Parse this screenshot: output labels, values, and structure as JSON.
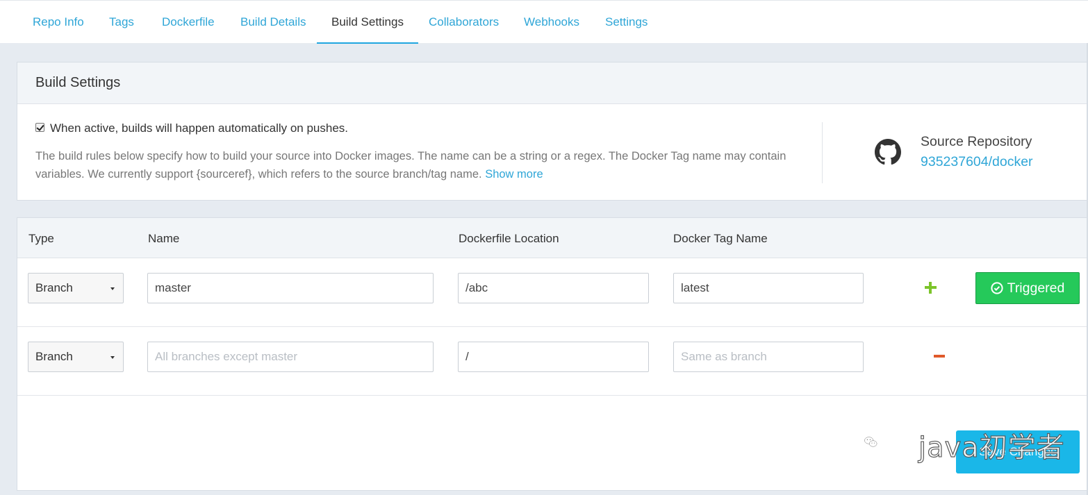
{
  "tabs": [
    {
      "label": "Repo Info"
    },
    {
      "label": "Tags"
    },
    {
      "label": "Dockerfile"
    },
    {
      "label": "Build Details"
    },
    {
      "label": "Build Settings",
      "active": true
    },
    {
      "label": "Collaborators"
    },
    {
      "label": "Webhooks"
    },
    {
      "label": "Settings"
    }
  ],
  "settings": {
    "title": "Build Settings",
    "autobuild_checked": true,
    "autobuild_label": "When active, builds will happen automatically on pushes.",
    "description": "The build rules below specify how to build your source into Docker images. The name can be a string or a regex. The Docker Tag name may contain variables. We currently support {sourceref}, which refers to the source branch/tag name.",
    "show_more": "Show more",
    "source_label": "Source Repository",
    "source_link": "935237604/docker",
    "source_icon": "github-icon"
  },
  "rules": {
    "headers": {
      "type": "Type",
      "name": "Name",
      "location": "Dockerfile Location",
      "tag": "Docker Tag Name"
    },
    "rows": [
      {
        "type": "Branch",
        "name": "master",
        "name_placeholder": "",
        "location": "/abc",
        "tag": "latest",
        "tag_placeholder": "",
        "action_icon": "plus-icon",
        "trigger_label": "Triggered",
        "trigger_icon": "check-circle-icon"
      },
      {
        "type": "Branch",
        "name": "",
        "name_placeholder": "All branches except master",
        "location": "/",
        "tag": "",
        "tag_placeholder": "Same as branch",
        "action_icon": "minus-icon"
      }
    ],
    "save_label": "Save Changes"
  },
  "watermark": {
    "text": "java初学者",
    "icon": "wechat-icon"
  },
  "colors": {
    "link": "#2fa6d7",
    "triggered": "#25c95a",
    "save": "#1ab7e8",
    "plus": "#7cc42a",
    "minus": "#e0592a"
  }
}
